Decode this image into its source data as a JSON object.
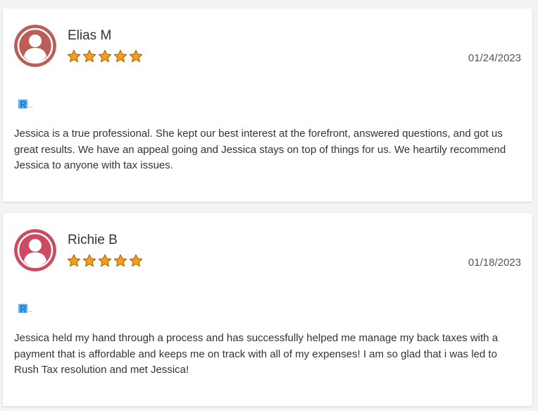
{
  "reviews": [
    {
      "name": "Elias M",
      "rating": 5,
      "date": "01/24/2023",
      "text": "Jessica is a true professional. She kept our best interest at the forefront, answered questions, and got us great results. We have an appeal going and Jessica stays on top of things for us. We heartily recommend Jessica to anyone with tax issues.",
      "avatar_color": "#b95e58",
      "avatar_icon": "user-icon",
      "source_icon": "source-logo-icon"
    },
    {
      "name": "Richie B",
      "rating": 5,
      "date": "01/18/2023",
      "text": "Jessica held my hand through a process and has successfully helped me manage my back taxes with a payment that is affordable and keeps me on track with all of my expenses! I am so glad that i was led to Rush Tax resolution and met Jessica!",
      "avatar_color": "#cc4b60",
      "avatar_icon": "user-icon",
      "source_icon": "source-logo-icon"
    }
  ],
  "colors": {
    "star_fill": "#f0a020",
    "star_stroke": "#b86a00",
    "logo_blue": "#1e7fe0",
    "logo_light_blue": "#5fb0f5"
  }
}
